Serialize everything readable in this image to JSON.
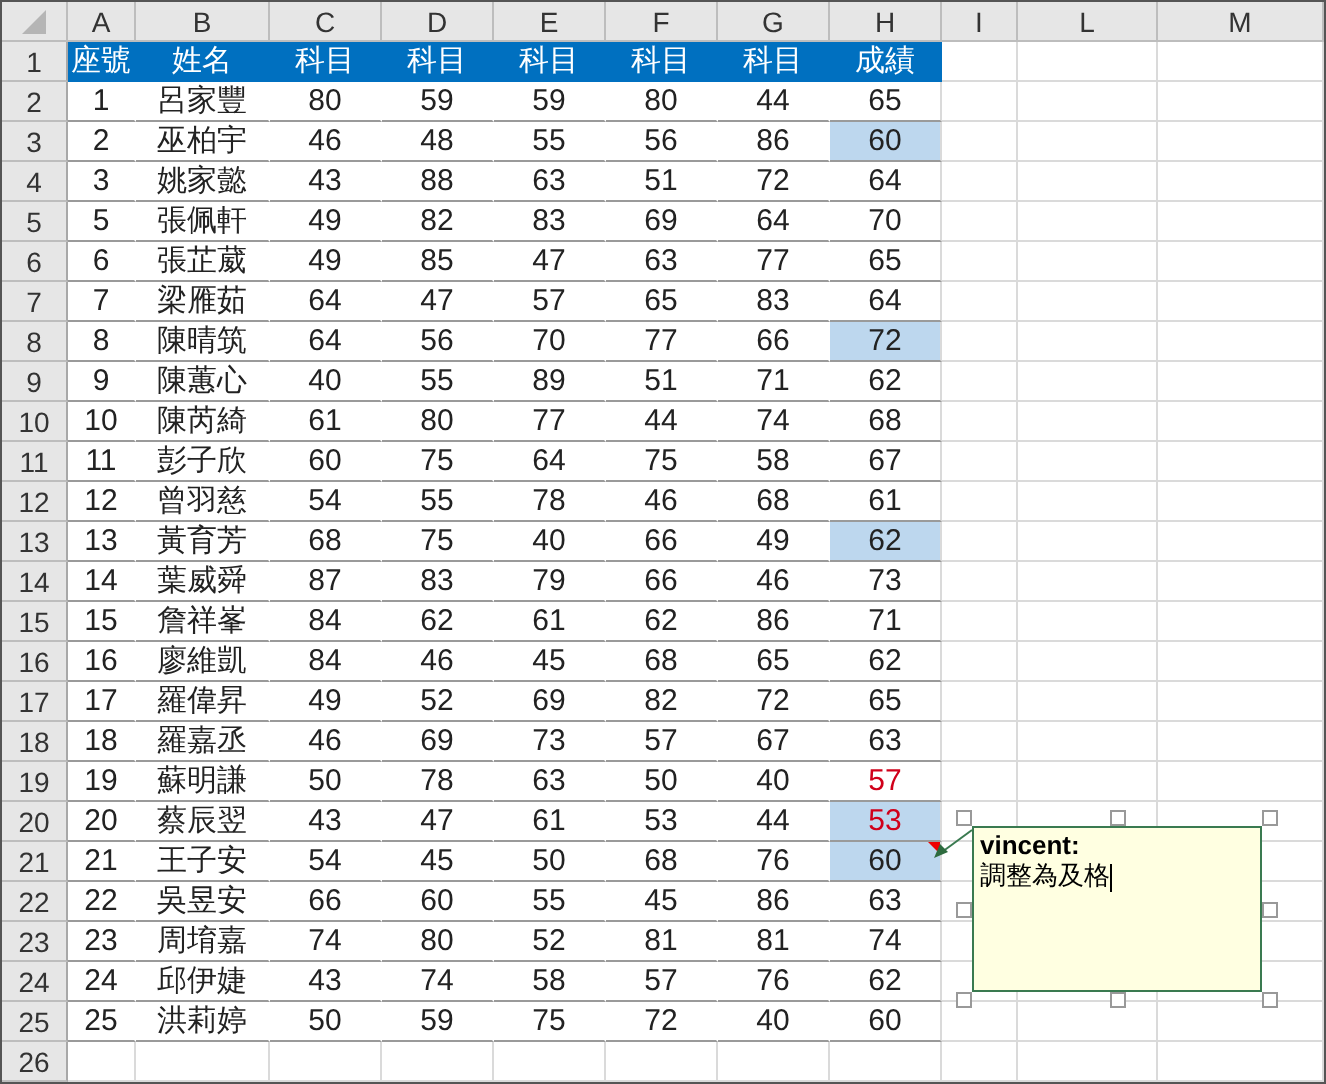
{
  "columns": [
    "A",
    "B",
    "C",
    "D",
    "E",
    "F",
    "G",
    "H",
    "I",
    "L",
    "M"
  ],
  "header_row": [
    "座號",
    "姓名",
    "科目",
    "科目",
    "科目",
    "科目",
    "科目",
    "成績"
  ],
  "rows": [
    {
      "seat": "1",
      "name": "呂家豐",
      "scores": [
        "80",
        "59",
        "59",
        "80",
        "44"
      ],
      "grade": {
        "value": "65",
        "highlighted": false,
        "failing": false,
        "has_comment": false
      }
    },
    {
      "seat": "2",
      "name": "巫柏宇",
      "scores": [
        "46",
        "48",
        "55",
        "56",
        "86"
      ],
      "grade": {
        "value": "60",
        "highlighted": true,
        "failing": false,
        "has_comment": false
      }
    },
    {
      "seat": "3",
      "name": "姚家懿",
      "scores": [
        "43",
        "88",
        "63",
        "51",
        "72"
      ],
      "grade": {
        "value": "64",
        "highlighted": false,
        "failing": false,
        "has_comment": false
      }
    },
    {
      "seat": "5",
      "name": "張佩軒",
      "scores": [
        "49",
        "82",
        "83",
        "69",
        "64"
      ],
      "grade": {
        "value": "70",
        "highlighted": false,
        "failing": false,
        "has_comment": false
      }
    },
    {
      "seat": "6",
      "name": "張芷葳",
      "scores": [
        "49",
        "85",
        "47",
        "63",
        "77"
      ],
      "grade": {
        "value": "65",
        "highlighted": false,
        "failing": false,
        "has_comment": false
      }
    },
    {
      "seat": "7",
      "name": "梁雁茹",
      "scores": [
        "64",
        "47",
        "57",
        "65",
        "83"
      ],
      "grade": {
        "value": "64",
        "highlighted": false,
        "failing": false,
        "has_comment": false
      }
    },
    {
      "seat": "8",
      "name": "陳晴筑",
      "scores": [
        "64",
        "56",
        "70",
        "77",
        "66"
      ],
      "grade": {
        "value": "72",
        "highlighted": true,
        "failing": false,
        "has_comment": false
      }
    },
    {
      "seat": "9",
      "name": "陳蕙心",
      "scores": [
        "40",
        "55",
        "89",
        "51",
        "71"
      ],
      "grade": {
        "value": "62",
        "highlighted": false,
        "failing": false,
        "has_comment": false
      }
    },
    {
      "seat": "10",
      "name": "陳芮綺",
      "scores": [
        "61",
        "80",
        "77",
        "44",
        "74"
      ],
      "grade": {
        "value": "68",
        "highlighted": false,
        "failing": false,
        "has_comment": false
      }
    },
    {
      "seat": "11",
      "name": "彭子欣",
      "scores": [
        "60",
        "75",
        "64",
        "75",
        "58"
      ],
      "grade": {
        "value": "67",
        "highlighted": false,
        "failing": false,
        "has_comment": false
      }
    },
    {
      "seat": "12",
      "name": "曾羽慈",
      "scores": [
        "54",
        "55",
        "78",
        "46",
        "68"
      ],
      "grade": {
        "value": "61",
        "highlighted": false,
        "failing": false,
        "has_comment": false
      }
    },
    {
      "seat": "13",
      "name": "黃育芳",
      "scores": [
        "68",
        "75",
        "40",
        "66",
        "49"
      ],
      "grade": {
        "value": "62",
        "highlighted": true,
        "failing": false,
        "has_comment": false
      }
    },
    {
      "seat": "14",
      "name": "葉威舜",
      "scores": [
        "87",
        "83",
        "79",
        "66",
        "46"
      ],
      "grade": {
        "value": "73",
        "highlighted": false,
        "failing": false,
        "has_comment": false
      }
    },
    {
      "seat": "15",
      "name": "詹祥峯",
      "scores": [
        "84",
        "62",
        "61",
        "62",
        "86"
      ],
      "grade": {
        "value": "71",
        "highlighted": false,
        "failing": false,
        "has_comment": false
      }
    },
    {
      "seat": "16",
      "name": "廖維凱",
      "scores": [
        "84",
        "46",
        "45",
        "68",
        "65"
      ],
      "grade": {
        "value": "62",
        "highlighted": false,
        "failing": false,
        "has_comment": false
      }
    },
    {
      "seat": "17",
      "name": "羅偉昇",
      "scores": [
        "49",
        "52",
        "69",
        "82",
        "72"
      ],
      "grade": {
        "value": "65",
        "highlighted": false,
        "failing": false,
        "has_comment": false
      }
    },
    {
      "seat": "18",
      "name": "羅嘉丞",
      "scores": [
        "46",
        "69",
        "73",
        "57",
        "67"
      ],
      "grade": {
        "value": "63",
        "highlighted": false,
        "failing": false,
        "has_comment": false
      }
    },
    {
      "seat": "19",
      "name": "蘇明謙",
      "scores": [
        "50",
        "78",
        "63",
        "50",
        "40"
      ],
      "grade": {
        "value": "57",
        "highlighted": false,
        "failing": true,
        "has_comment": false
      }
    },
    {
      "seat": "20",
      "name": "蔡辰翌",
      "scores": [
        "43",
        "47",
        "61",
        "53",
        "44"
      ],
      "grade": {
        "value": "53",
        "highlighted": true,
        "failing": true,
        "has_comment": false
      }
    },
    {
      "seat": "21",
      "name": "王子安",
      "scores": [
        "54",
        "45",
        "50",
        "68",
        "76"
      ],
      "grade": {
        "value": "60",
        "highlighted": true,
        "failing": false,
        "has_comment": true
      }
    },
    {
      "seat": "22",
      "name": "吳昱安",
      "scores": [
        "66",
        "60",
        "55",
        "45",
        "86"
      ],
      "grade": {
        "value": "63",
        "highlighted": false,
        "failing": false,
        "has_comment": false
      }
    },
    {
      "seat": "23",
      "name": "周堉嘉",
      "scores": [
        "74",
        "80",
        "52",
        "81",
        "81"
      ],
      "grade": {
        "value": "74",
        "highlighted": false,
        "failing": false,
        "has_comment": false
      }
    },
    {
      "seat": "24",
      "name": "邱伊婕",
      "scores": [
        "43",
        "74",
        "58",
        "57",
        "76"
      ],
      "grade": {
        "value": "62",
        "highlighted": false,
        "failing": false,
        "has_comment": false
      }
    },
    {
      "seat": "25",
      "name": "洪莉婷",
      "scores": [
        "50",
        "59",
        "75",
        "72",
        "40"
      ],
      "grade": {
        "value": "60",
        "highlighted": false,
        "failing": false,
        "has_comment": false
      }
    }
  ],
  "row_numbers": [
    "1",
    "2",
    "3",
    "4",
    "5",
    "6",
    "7",
    "8",
    "9",
    "10",
    "11",
    "12",
    "13",
    "14",
    "15",
    "16",
    "17",
    "18",
    "19",
    "20",
    "21",
    "22",
    "23",
    "24",
    "25",
    "26"
  ],
  "comment": {
    "author": "vincent:",
    "text": "調整為及格"
  }
}
